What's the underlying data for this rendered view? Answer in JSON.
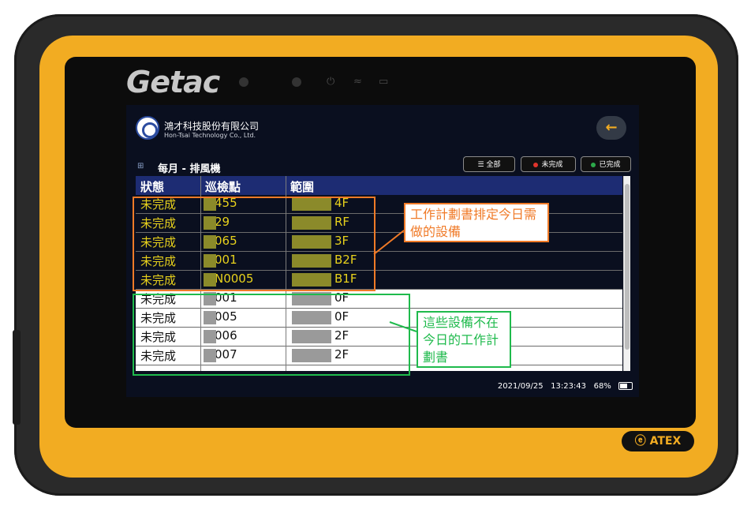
{
  "device": {
    "brand": "Getac",
    "badge": "ATEX",
    "badge_icon": "ex-icon"
  },
  "app": {
    "company_name": "鴻才科技股份有限公司",
    "company_en": "Hon-Tsai Technology Co., Ltd.",
    "page_title": "每月 - 排風機",
    "filters": [
      {
        "label": "全部",
        "icon": "menu-icon"
      },
      {
        "label": "未完成",
        "dot": "#e0342c"
      },
      {
        "label": "已完成",
        "dot": "#2ca84a"
      }
    ],
    "table": {
      "headers": [
        "狀態",
        "巡檢點",
        "範圍"
      ],
      "rows": [
        {
          "status": "未完成",
          "point": "455",
          "range": "4F",
          "highlight": true
        },
        {
          "status": "未完成",
          "point": "29",
          "range": "RF",
          "highlight": true
        },
        {
          "status": "未完成",
          "point": "065",
          "range": "3F",
          "highlight": true
        },
        {
          "status": "未完成",
          "point": "001",
          "range": "B2F",
          "highlight": true
        },
        {
          "status": "未完成",
          "point": "N0005",
          "range": "B1F",
          "highlight": true
        },
        {
          "status": "未完成",
          "point": "001",
          "range": "0F",
          "highlight": false
        },
        {
          "status": "未完成",
          "point": "005",
          "range": "0F",
          "highlight": false
        },
        {
          "status": "未完成",
          "point": "006",
          "range": "2F",
          "highlight": false
        },
        {
          "status": "未完成",
          "point": "007",
          "range": "2F",
          "highlight": false
        }
      ]
    },
    "status_bar": {
      "date": "2021/09/25",
      "time": "13:23:43",
      "battery": "68%"
    }
  },
  "annotations": {
    "orange": "工作計劃書排定今日需做的設備",
    "green": "這些設備不在今日的工作計劃書"
  },
  "colors": {
    "yellow_text": "#e7d11c",
    "orange": "#f07a27",
    "green": "#1fba4c",
    "bumper": "#f2ac22",
    "header": "#1d2c73"
  }
}
